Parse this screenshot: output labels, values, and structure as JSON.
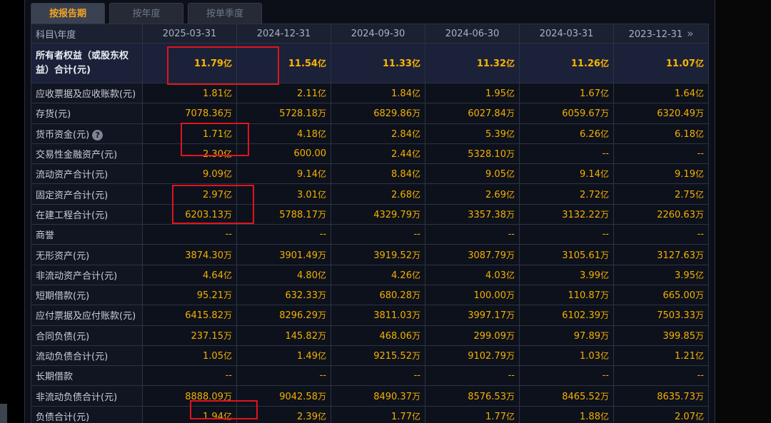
{
  "tabs": [
    {
      "label": "按报告期",
      "active": true
    },
    {
      "label": "按年度",
      "active": false
    },
    {
      "label": "按单季度",
      "active": false
    }
  ],
  "header": {
    "first_col": "科目\\年度",
    "periods": [
      "2025-03-31",
      "2024-12-31",
      "2024-09-30",
      "2024-06-30",
      "2024-03-31",
      "2023-12-31"
    ],
    "more_icon": "double-chevron-right-icon"
  },
  "rows": [
    {
      "label": "所有者权益（或股东权益）合计(元)",
      "values": [
        [
          "11.79",
          "亿"
        ],
        [
          "11.54",
          "亿"
        ],
        [
          "11.33",
          "亿"
        ],
        [
          "11.32",
          "亿"
        ],
        [
          "11.26",
          "亿"
        ],
        [
          "11.07",
          "亿"
        ]
      ]
    },
    {
      "label": "应收票据及应收账款(元)",
      "values": [
        [
          "1.81",
          "亿"
        ],
        [
          "2.11",
          "亿"
        ],
        [
          "1.84",
          "亿"
        ],
        [
          "1.95",
          "亿"
        ],
        [
          "1.67",
          "亿"
        ],
        [
          "1.64",
          "亿"
        ]
      ]
    },
    {
      "label": "存货(元)",
      "values": [
        [
          "7078.36",
          "万"
        ],
        [
          "5728.18",
          "万"
        ],
        [
          "6829.86",
          "万"
        ],
        [
          "6027.84",
          "万"
        ],
        [
          "6059.67",
          "万"
        ],
        [
          "6320.49",
          "万"
        ]
      ]
    },
    {
      "label": "货币资金(元)",
      "help": "?",
      "values": [
        [
          "1.71",
          "亿"
        ],
        [
          "4.18",
          "亿"
        ],
        [
          "2.84",
          "亿"
        ],
        [
          "5.39",
          "亿"
        ],
        [
          "6.26",
          "亿"
        ],
        [
          "6.18",
          "亿"
        ]
      ]
    },
    {
      "label": "交易性金融资产(元)",
      "values": [
        [
          "2.30",
          "亿"
        ],
        [
          "600.00",
          ""
        ],
        [
          "2.44",
          "亿"
        ],
        [
          "5328.10",
          "万"
        ],
        [
          "--",
          ""
        ],
        [
          "--",
          ""
        ]
      ]
    },
    {
      "label": "流动资产合计(元)",
      "values": [
        [
          "9.09",
          "亿"
        ],
        [
          "9.14",
          "亿"
        ],
        [
          "8.84",
          "亿"
        ],
        [
          "9.05",
          "亿"
        ],
        [
          "9.14",
          "亿"
        ],
        [
          "9.19",
          "亿"
        ]
      ]
    },
    {
      "label": "固定资产合计(元)",
      "values": [
        [
          "2.97",
          "亿"
        ],
        [
          "3.01",
          "亿"
        ],
        [
          "2.68",
          "亿"
        ],
        [
          "2.69",
          "亿"
        ],
        [
          "2.72",
          "亿"
        ],
        [
          "2.75",
          "亿"
        ]
      ]
    },
    {
      "label": "在建工程合计(元)",
      "values": [
        [
          "6203.13",
          "万"
        ],
        [
          "5788.17",
          "万"
        ],
        [
          "4329.79",
          "万"
        ],
        [
          "3357.38",
          "万"
        ],
        [
          "3132.22",
          "万"
        ],
        [
          "2260.63",
          "万"
        ]
      ]
    },
    {
      "label": "商誉",
      "values": [
        [
          "--",
          ""
        ],
        [
          "--",
          ""
        ],
        [
          "--",
          ""
        ],
        [
          "--",
          ""
        ],
        [
          "--",
          ""
        ],
        [
          "--",
          ""
        ]
      ]
    },
    {
      "label": "无形资产(元)",
      "values": [
        [
          "3874.30",
          "万"
        ],
        [
          "3901.49",
          "万"
        ],
        [
          "3919.52",
          "万"
        ],
        [
          "3087.79",
          "万"
        ],
        [
          "3105.61",
          "万"
        ],
        [
          "3127.63",
          "万"
        ]
      ]
    },
    {
      "label": "非流动资产合计(元)",
      "values": [
        [
          "4.64",
          "亿"
        ],
        [
          "4.80",
          "亿"
        ],
        [
          "4.26",
          "亿"
        ],
        [
          "4.03",
          "亿"
        ],
        [
          "3.99",
          "亿"
        ],
        [
          "3.95",
          "亿"
        ]
      ]
    },
    {
      "label": "短期借款(元)",
      "values": [
        [
          "95.21",
          "万"
        ],
        [
          "632.33",
          "万"
        ],
        [
          "680.28",
          "万"
        ],
        [
          "100.00",
          "万"
        ],
        [
          "110.87",
          "万"
        ],
        [
          "665.00",
          "万"
        ]
      ]
    },
    {
      "label": "应付票据及应付账款(元)",
      "values": [
        [
          "6415.82",
          "万"
        ],
        [
          "8296.29",
          "万"
        ],
        [
          "3811.03",
          "万"
        ],
        [
          "3997.17",
          "万"
        ],
        [
          "6102.39",
          "万"
        ],
        [
          "7503.33",
          "万"
        ]
      ]
    },
    {
      "label": "合同负债(元)",
      "values": [
        [
          "237.15",
          "万"
        ],
        [
          "145.82",
          "万"
        ],
        [
          "468.06",
          "万"
        ],
        [
          "299.09",
          "万"
        ],
        [
          "97.89",
          "万"
        ],
        [
          "399.85",
          "万"
        ]
      ]
    },
    {
      "label": "流动负债合计(元)",
      "values": [
        [
          "1.05",
          "亿"
        ],
        [
          "1.49",
          "亿"
        ],
        [
          "9215.52",
          "万"
        ],
        [
          "9102.79",
          "万"
        ],
        [
          "1.03",
          "亿"
        ],
        [
          "1.21",
          "亿"
        ]
      ]
    },
    {
      "label": "长期借款",
      "values": [
        [
          "--",
          ""
        ],
        [
          "--",
          ""
        ],
        [
          "--",
          ""
        ],
        [
          "--",
          ""
        ],
        [
          "--",
          ""
        ],
        [
          "--",
          ""
        ]
      ]
    },
    {
      "label": "非流动负债合计(元)",
      "values": [
        [
          "8888.09",
          "万"
        ],
        [
          "9042.58",
          "万"
        ],
        [
          "8490.37",
          "万"
        ],
        [
          "8576.53",
          "万"
        ],
        [
          "8465.52",
          "万"
        ],
        [
          "8635.73",
          "万"
        ]
      ]
    },
    {
      "label": "负债合计(元)",
      "values": [
        [
          "1.94",
          "亿"
        ],
        [
          "2.39",
          "亿"
        ],
        [
          "1.77",
          "亿"
        ],
        [
          "1.77",
          "亿"
        ],
        [
          "1.88",
          "亿"
        ],
        [
          "2.07",
          "亿"
        ]
      ]
    }
  ],
  "colors": {
    "value": "#f5b000",
    "accent_tab": "#f5a623",
    "annotation": "#e0141e"
  }
}
